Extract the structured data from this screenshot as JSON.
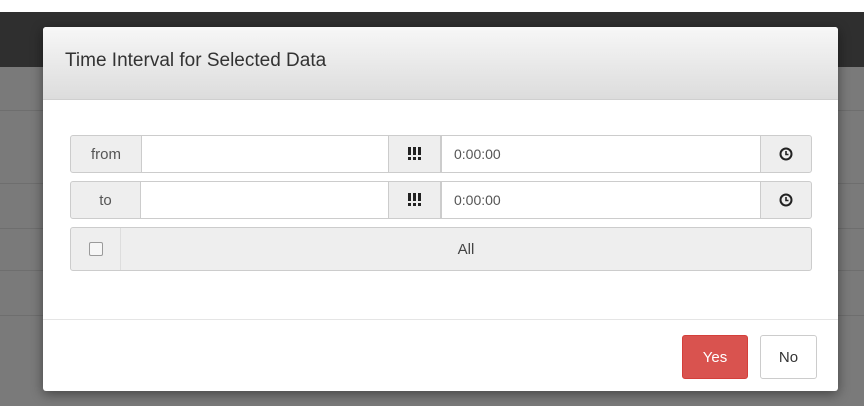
{
  "modal": {
    "title": "Time Interval for Selected Data",
    "from": {
      "label": "from",
      "date_value": "",
      "time_value": "0:00:00"
    },
    "to": {
      "label": "to",
      "date_value": "",
      "time_value": "0:00:00"
    },
    "all": {
      "label": "All",
      "checked": false
    },
    "buttons": {
      "yes": "Yes",
      "no": "No"
    }
  },
  "icons": {
    "date_picker": "calendar-grid-icon",
    "time_picker": "clock-icon"
  },
  "colors": {
    "primary_danger": "#d9534f",
    "header_gradient_top": "#f7f7f7",
    "header_gradient_bottom": "#dcdcdc"
  }
}
